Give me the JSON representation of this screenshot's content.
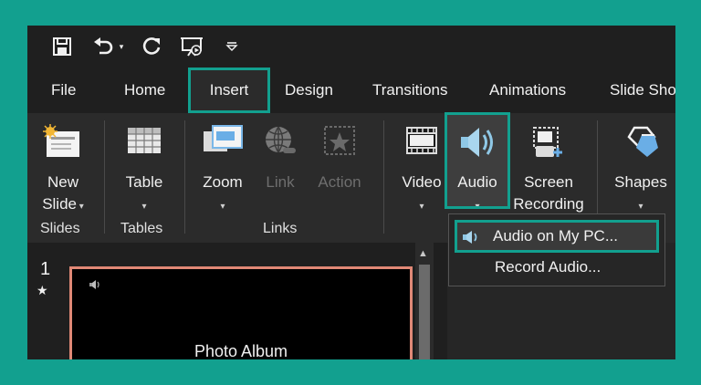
{
  "qat": {
    "icons": [
      "save-icon",
      "undo-icon",
      "redo-icon",
      "from-beginning-icon",
      "customize-qat-icon"
    ]
  },
  "tabs": [
    {
      "label": "File"
    },
    {
      "label": "Home"
    },
    {
      "label": "Insert",
      "active": true
    },
    {
      "label": "Design"
    },
    {
      "label": "Transitions"
    },
    {
      "label": "Animations"
    },
    {
      "label": "Slide Sho"
    }
  ],
  "ribbon": {
    "new_slide": {
      "line1": "New",
      "line2": "Slide"
    },
    "table": {
      "label": "Table"
    },
    "zoom": {
      "label": "Zoom"
    },
    "link": {
      "label": "Link"
    },
    "action": {
      "label": "Action"
    },
    "video": {
      "label": "Video"
    },
    "audio": {
      "label": "Audio"
    },
    "screen_recording": {
      "line1": "Screen",
      "line2": "Recording"
    },
    "shapes": {
      "label": "Shapes"
    },
    "groups": {
      "slides": "Slides",
      "tables": "Tables",
      "links": "Links"
    }
  },
  "audio_menu": {
    "item1": "Audio on My PC...",
    "item2": "Record Audio..."
  },
  "slides": {
    "number": "1",
    "star": "★",
    "thumb_title": "Photo Album"
  },
  "colors": {
    "accent": "#12a08f",
    "thumb_border": "#e08876",
    "background": "#1f1f1f",
    "ribbon": "#2b2b2b"
  }
}
